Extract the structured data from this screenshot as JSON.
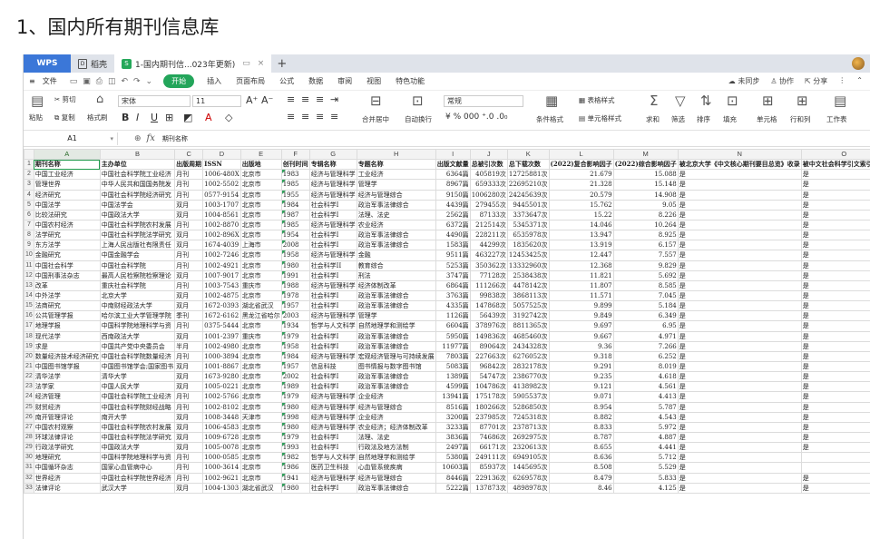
{
  "page_heading": "1、国内所有期刊信息库",
  "titlebar": {
    "app": "WPS",
    "tab1": "稻壳",
    "tab2": "1-国内期刊信...023年更新)",
    "plus": "+"
  },
  "menubar": {
    "file": "文件",
    "start": "开始",
    "items": [
      "插入",
      "页面布局",
      "公式",
      "数据",
      "审阅",
      "视图",
      "特色功能"
    ],
    "unsynced": "未同步",
    "collab": "协作",
    "share": "分享"
  },
  "ribbon": {
    "cut": "剪切",
    "paste": "粘贴",
    "copy": "复制",
    "format_painter": "格式刷",
    "font": "宋体",
    "size": "11",
    "merge": "合并居中",
    "wrap": "自动换行",
    "numfmt": "常规",
    "table_style": "表格样式",
    "cond_format": "条件格式",
    "cell_style": "单元格样式",
    "sum": "求和",
    "filter": "筛选",
    "sort": "排序",
    "fill": "填充",
    "cell": "单元格",
    "rowcol": "行和列",
    "worksheet": "工作表",
    "percent": "%",
    "thousands": "000"
  },
  "formulabar": {
    "cell": "A1",
    "fx": "fx",
    "content": "期刊名称"
  },
  "columns": [
    "A",
    "B",
    "C",
    "D",
    "E",
    "F",
    "G",
    "H",
    "I",
    "J",
    "K",
    "L",
    "M",
    "N",
    "O"
  ],
  "header_row": [
    "期刊名称",
    "主办单位",
    "出版周期",
    "ISSN",
    "出版地",
    "创刊时间",
    "专辑名称",
    "专题名称",
    "出版文献量",
    "总被引次数",
    "总下载次数",
    "(2022)复合影响因子",
    "(2022)综合影响因子",
    "被北京大学《中文核心期刊要目总览》收录",
    "被中文社会科学引文索引收录",
    "被中"
  ],
  "rows": [
    [
      "中国工业经济",
      "中国社会科学院工业经济",
      "月刊",
      "1006-480X",
      "北京市",
      "1983",
      "经济与管理科学",
      "工业经济",
      "6364篇",
      "405819次",
      "12725881次",
      "21.679",
      "15.088",
      "是",
      "是"
    ],
    [
      "管理世界",
      "中华人民共和国国务院发",
      "月刊",
      "1002-5502",
      "北京市",
      "1985",
      "经济与管理科学",
      "管理学",
      "8967篇",
      "659333次",
      "22695210次",
      "21.328",
      "15.148",
      "是",
      "是"
    ],
    [
      "经济研究",
      "中国社会科学院经济研究",
      "月刊",
      "0577-9154",
      "北京市",
      "1955",
      "经济与管理科学",
      "经济与管理综合",
      "9150篇",
      "1006280次",
      "24245639次",
      "20.579",
      "14.908",
      "是",
      "是"
    ],
    [
      "中国法学",
      "中国法学会",
      "双月",
      "1003-1707",
      "北京市",
      "1984",
      "社会科学I",
      "政治军事法律综合",
      "4439篇",
      "279455次",
      "9445501次",
      "15.762",
      "9.05",
      "是",
      "是"
    ],
    [
      "比较法研究",
      "中国政法大学",
      "双月",
      "1004-8561",
      "北京市",
      "1987",
      "社会科学I",
      "法理、法史",
      "2562篇",
      "87133次",
      "3373647次",
      "15.22",
      "8.226",
      "是",
      "是"
    ],
    [
      "中国农村经济",
      "中国社会科学院农村发展",
      "月刊",
      "1002-8870",
      "北京市",
      "1985",
      "经济与管理科学",
      "农业经济",
      "6372篇",
      "212514次",
      "5345371次",
      "14.046",
      "10.264",
      "是",
      "是"
    ],
    [
      "法学研究",
      "中国社会科学院法学研究",
      "双月",
      "1002-896X",
      "北京市",
      "1954",
      "社会科学I",
      "政治军事法律综合",
      "4490篇",
      "228211次",
      "6535978次",
      "13.947",
      "8.925",
      "是",
      "是"
    ],
    [
      "东方法学",
      "上海人民出版社有限责任",
      "双月",
      "1674-4039",
      "上海市",
      "2008",
      "社会科学I",
      "政治军事法律综合",
      "1583篇",
      "44299次",
      "1835620次",
      "13.919",
      "6.157",
      "是",
      "是"
    ],
    [
      "金融研究",
      "中国金融学会",
      "月刊",
      "1002-7246",
      "北京市",
      "1958",
      "经济与管理科学",
      "金融",
      "9511篇",
      "463227次",
      "12453425次",
      "12.447",
      "7.557",
      "是",
      "是"
    ],
    [
      "中国社会科学",
      "中国社会科学院",
      "月刊",
      "1002-4921",
      "北京市",
      "1980",
      "社会科学II",
      "教育综合",
      "5253篇",
      "350362次",
      "13332960次",
      "12.368",
      "9.829",
      "是",
      "是"
    ],
    [
      "中国刑事法杂志",
      "最高人民检察院检察理论",
      "双月",
      "1007-9017",
      "北京市",
      "1991",
      "社会科学I",
      "刑法",
      "3747篇",
      "77128次",
      "2538438次",
      "11.821",
      "5.692",
      "是",
      "是"
    ],
    [
      "改革",
      "重庆社会科学院",
      "月刊",
      "1003-7543",
      "重庆市",
      "1988",
      "经济与管理科学",
      "经济体制改革",
      "6864篇",
      "111266次",
      "4478142次",
      "11.807",
      "8.585",
      "是",
      "是"
    ],
    [
      "中外法学",
      "北京大学",
      "双月",
      "1002-4875",
      "北京市",
      "1978",
      "社会科学I",
      "政治军事法律综合",
      "3763篇",
      "99838次",
      "3868113次",
      "11.571",
      "7.045",
      "是",
      "是"
    ],
    [
      "法商研究",
      "中南财经政法大学",
      "双月",
      "1672-0393",
      "湖北省武汉",
      "1957",
      "社会科学I",
      "政治军事法律综合",
      "4335篇",
      "147868次",
      "5057525次",
      "9.899",
      "5.184",
      "是",
      "是"
    ],
    [
      "公共管理学报",
      "哈尔滨工业大学管理学院",
      "季刊",
      "1672-6162",
      "黑龙江省哈尔",
      "2003",
      "经济与管理科学",
      "管理学",
      "1126篇",
      "56439次",
      "3192742次",
      "9.849",
      "6.349",
      "是",
      "是"
    ],
    [
      "地理学报",
      "中国科学院地理科学与资",
      "月刊",
      "0375-5444",
      "北京市",
      "1934",
      "哲学与人文科学",
      "自然地理学和测绘学",
      "6604篇",
      "378976次",
      "8811365次",
      "9.697",
      "6.95",
      "是",
      "是"
    ],
    [
      "现代法学",
      "西南政法大学",
      "双月",
      "1001-2397",
      "重庆市",
      "1979",
      "社会科学I",
      "政治军事法律综合",
      "5950篇",
      "149836次",
      "4685460次",
      "9.667",
      "4.971",
      "是",
      "是"
    ],
    [
      "求是",
      "中国共产党中央委员会",
      "半月",
      "1002-4980",
      "北京市",
      "1958",
      "社会科学I",
      "政治军事法律综合",
      "11977篇",
      "89064次",
      "2434328次",
      "9.36",
      "7.266",
      "是",
      "是"
    ],
    [
      "数量经济技术经济研究",
      "中国社会科学院数量经济",
      "月刊",
      "1000-3894",
      "北京市",
      "1984",
      "经济与管理科学",
      "宏观经济管理与可持续发展",
      "7803篇",
      "227663次",
      "6276052次",
      "9.318",
      "6.252",
      "是",
      "是"
    ],
    [
      "中国图书馆学报",
      "中国图书馆学会;国家图书",
      "双月",
      "1001-8867",
      "北京市",
      "1957",
      "信息科技",
      "图书情报与数字图书馆",
      "5083篇",
      "96842次",
      "2832178次",
      "9.291",
      "8.019",
      "是",
      "是"
    ],
    [
      "清华法学",
      "清华大学",
      "双月",
      "1673-9280",
      "北京市",
      "2002",
      "社会科学I",
      "政治军事法律综合",
      "1389篇",
      "54747次",
      "2386770次",
      "9.235",
      "4.618",
      "是",
      "是"
    ],
    [
      "法学家",
      "中国人民大学",
      "双月",
      "1005-0221",
      "北京市",
      "1989",
      "社会科学I",
      "政治军事法律综合",
      "4599篇",
      "104786次",
      "4138982次",
      "9.121",
      "4.561",
      "是",
      "是"
    ],
    [
      "经济管理",
      "中国社会科学院工业经济",
      "月刊",
      "1002-5766",
      "北京市",
      "1979",
      "经济与管理科学",
      "企业经济",
      "13941篇",
      "175178次",
      "5905537次",
      "9.071",
      "4.413",
      "是",
      "是"
    ],
    [
      "财贸经济",
      "中国社会科学院财经战略",
      "月刊",
      "1002-8102",
      "北京市",
      "1980",
      "经济与管理科学",
      "经济与管理综合",
      "8516篇",
      "180266次",
      "5286850次",
      "8.954",
      "5.787",
      "是",
      "是"
    ],
    [
      "南开管理评论",
      "南开大学",
      "双月",
      "1008-3448",
      "天津市",
      "1998",
      "经济与管理科学",
      "企业经济",
      "3200篇",
      "237985次",
      "7245318次",
      "8.882",
      "4.543",
      "是",
      "是"
    ],
    [
      "中国农村观察",
      "中国社会科学院农村发展",
      "双月",
      "1006-4583",
      "北京市",
      "1980",
      "经济与管理科学",
      "农业经济；经济体制改革",
      "3233篇",
      "87701次",
      "2378713次",
      "8.833",
      "5.972",
      "是",
      "是"
    ],
    [
      "环球法律评论",
      "中国社会科学院法学研究",
      "双月",
      "1009-6728",
      "北京市",
      "1979",
      "社会科学I",
      "法理、法史",
      "3836篇",
      "74686次",
      "2692975次",
      "8.787",
      "4.887",
      "是",
      "是"
    ],
    [
      "行政法学研究",
      "中国政法大学",
      "双月",
      "1005-0078",
      "北京市",
      "1993",
      "社会科学I",
      "行政法及地方法制",
      "2497篇",
      "66171次",
      "2320613次",
      "8.655",
      "4.441",
      "是",
      "是"
    ],
    [
      "地理研究",
      "中国科学院地理科学与资",
      "月刊",
      "1000-0585",
      "北京市",
      "1982",
      "哲学与人文科学",
      "自然地理学和测绘学",
      "5380篇",
      "249111次",
      "6949105次",
      "8.636",
      "5.712",
      "是",
      ""
    ],
    [
      "中国循环杂志",
      "国家心血管病中心",
      "月刊",
      "1000-3614",
      "北京市",
      "1986",
      "医药卫生科技",
      "心血管系统疾病",
      "10603篇",
      "85937次",
      "1445695次",
      "8.508",
      "5.529",
      "是",
      ""
    ],
    [
      "世界经济",
      "中国社会科学院世界经济",
      "月刊",
      "1002-9621",
      "北京市",
      "1941",
      "经济与管理科学",
      "经济与管理综合",
      "8446篇",
      "229136次",
      "6269578次",
      "8.479",
      "5.833",
      "是",
      "是"
    ],
    [
      "法律评论",
      "武汉大学",
      "双月",
      "1004-1303",
      "湖北省武汉",
      "1980",
      "社会科学I",
      "政治军事法律综合",
      "5222篇",
      "137873次",
      "4898978次",
      "8.46",
      "4.125",
      "是",
      "是"
    ]
  ]
}
